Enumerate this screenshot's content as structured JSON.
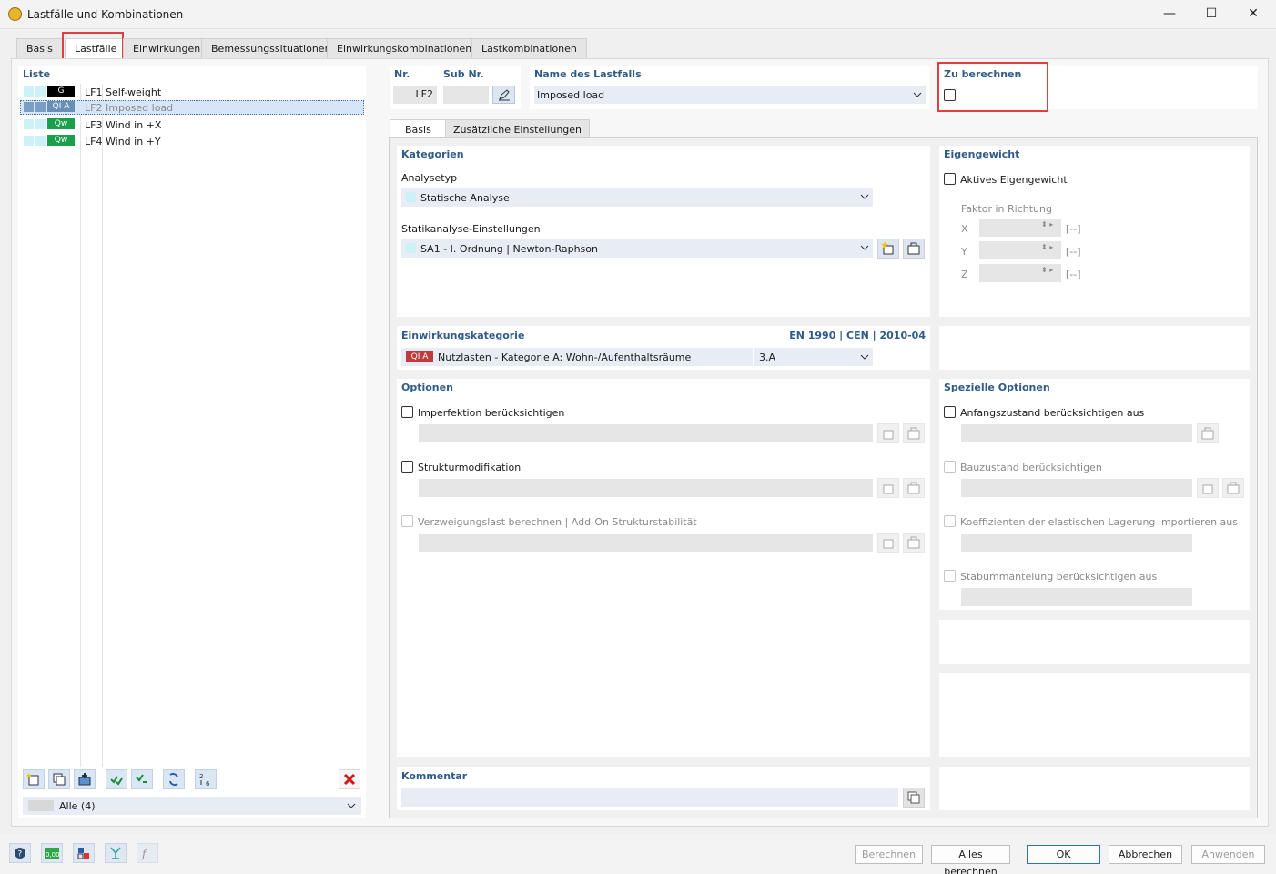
{
  "window": {
    "title": "Lastfälle und Kombinationen"
  },
  "tabs": [
    "Basis",
    "Lastfälle",
    "Einwirkungen",
    "Bemessungssituationen",
    "Einwirkungskombinationen",
    "Lastkombinationen"
  ],
  "list": {
    "title": "Liste",
    "items": [
      {
        "badge": "G",
        "badge_color": "#000000",
        "id": "LF1",
        "name": "Self-weight"
      },
      {
        "badge": "QI A",
        "badge_color": "#6a8fb5",
        "id": "LF2",
        "name": "Imposed load"
      },
      {
        "badge": "Qw",
        "badge_color": "#1aa04a",
        "id": "LF3",
        "name": "Wind in +X"
      },
      {
        "badge": "Qw",
        "badge_color": "#1aa04a",
        "id": "LF4",
        "name": "Wind in +Y"
      }
    ],
    "filter": "Alle (4)"
  },
  "header": {
    "nr_label": "Nr.",
    "nr_value": "LF2",
    "subnr_label": "Sub Nr.",
    "name_label": "Name des Lastfalls",
    "name_value": "Imposed load",
    "calc_label": "Zu berechnen"
  },
  "subtabs": [
    "Basis",
    "Zusätzliche Einstellungen"
  ],
  "kategorien": {
    "title": "Kategorien",
    "analysetyp_label": "Analysetyp",
    "analysetyp_value": "Statische Analyse",
    "settings_label": "Statikanalyse-Einstellungen",
    "settings_value": "SA1 - I. Ordnung | Newton-Raphson"
  },
  "eigengewicht": {
    "title": "Eigengewicht",
    "checkbox_label": "Aktives Eigengewicht",
    "factor_label": "Faktor in Richtung",
    "axes": [
      "X",
      "Y",
      "Z"
    ],
    "unit": "[--]"
  },
  "einwirkung": {
    "title": "Einwirkungskategorie",
    "norm": "EN 1990 | CEN | 2010-04",
    "badge": "QI A",
    "value": "Nutzlasten - Kategorie A: Wohn-/Aufenthaltsräume",
    "code": "3.A"
  },
  "optionen": {
    "title": "Optionen",
    "items": [
      "Imperfektion berücksichtigen",
      "Strukturmodifikation",
      "Verzweigungslast berechnen | Add-On Strukturstabilität"
    ]
  },
  "spezielle": {
    "title": "Spezielle Optionen",
    "items": [
      "Anfangszustand berücksichtigen aus",
      "Bauzustand berücksichtigen",
      "Koeffizienten der elastischen Lagerung importieren aus",
      "Stabummantelung berücksichtigen aus"
    ]
  },
  "kommentar": {
    "title": "Kommentar"
  },
  "buttons": {
    "berechnen": "Berechnen",
    "alles": "Alles berechnen",
    "ok": "OK",
    "abbrechen": "Abbrechen",
    "anwenden": "Anwenden"
  },
  "bottom_icons": [
    "help-icon",
    "units-icon",
    "display-icon",
    "model-icon",
    "function-icon"
  ]
}
